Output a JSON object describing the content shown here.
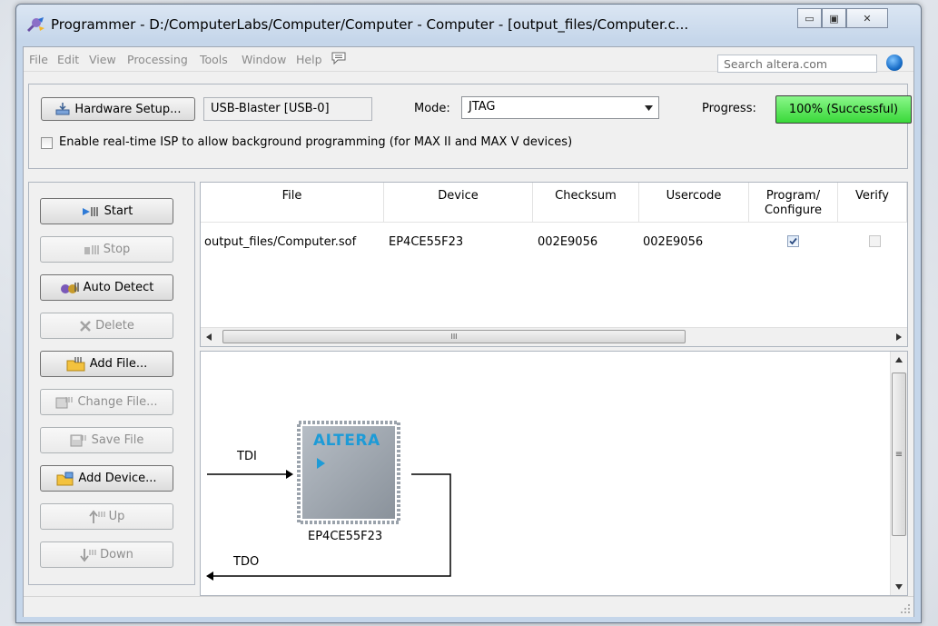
{
  "window": {
    "title": "Programmer - D:/ComputerLabs/Computer/Computer - Computer - [output_files/Computer.c...",
    "minimize_label": "▭",
    "maximize_label": "▣",
    "close_label": "✕"
  },
  "menu": {
    "items": [
      "File",
      "Edit",
      "View",
      "Processing",
      "Tools",
      "Window",
      "Help"
    ],
    "search_placeholder": "Search altera.com"
  },
  "hardware": {
    "setup_button": "Hardware Setup...",
    "device_value": "USB-Blaster [USB-0]",
    "mode_label": "Mode:",
    "mode_value": "JTAG",
    "progress_label": "Progress:",
    "progress_value": "100% (Successful)",
    "progress_fraction": 1.0,
    "isp_checkbox_label": "Enable real-time ISP to allow background programming (for MAX II and MAX V devices)",
    "isp_checked": false
  },
  "actions": {
    "start": "Start",
    "stop": "Stop",
    "auto_detect": "Auto Detect",
    "delete": "Delete",
    "add_file": "Add File...",
    "change_file": "Change File...",
    "save_file": "Save File",
    "add_device": "Add Device...",
    "up": "Up",
    "down": "Down"
  },
  "table": {
    "headers": [
      "File",
      "Device",
      "Checksum",
      "Usercode",
      "Program/\nConfigure",
      "Verify"
    ],
    "rows": [
      {
        "file": "output_files/Computer.sof",
        "device": "EP4CE55F23",
        "checksum": "002E9056",
        "usercode": "002E9056",
        "program_configure": true,
        "verify": false
      }
    ],
    "hscroll_label": "III"
  },
  "chain": {
    "tdi_label": "TDI",
    "tdo_label": "TDO",
    "chip_name": "EP4CE55F23",
    "chip_logo": "ALTERA",
    "vscroll_label": "≡"
  },
  "colors": {
    "progress_green": "#39d839",
    "chip_gray": "#9aa2ab",
    "logo_blue": "#1d9bd7"
  }
}
